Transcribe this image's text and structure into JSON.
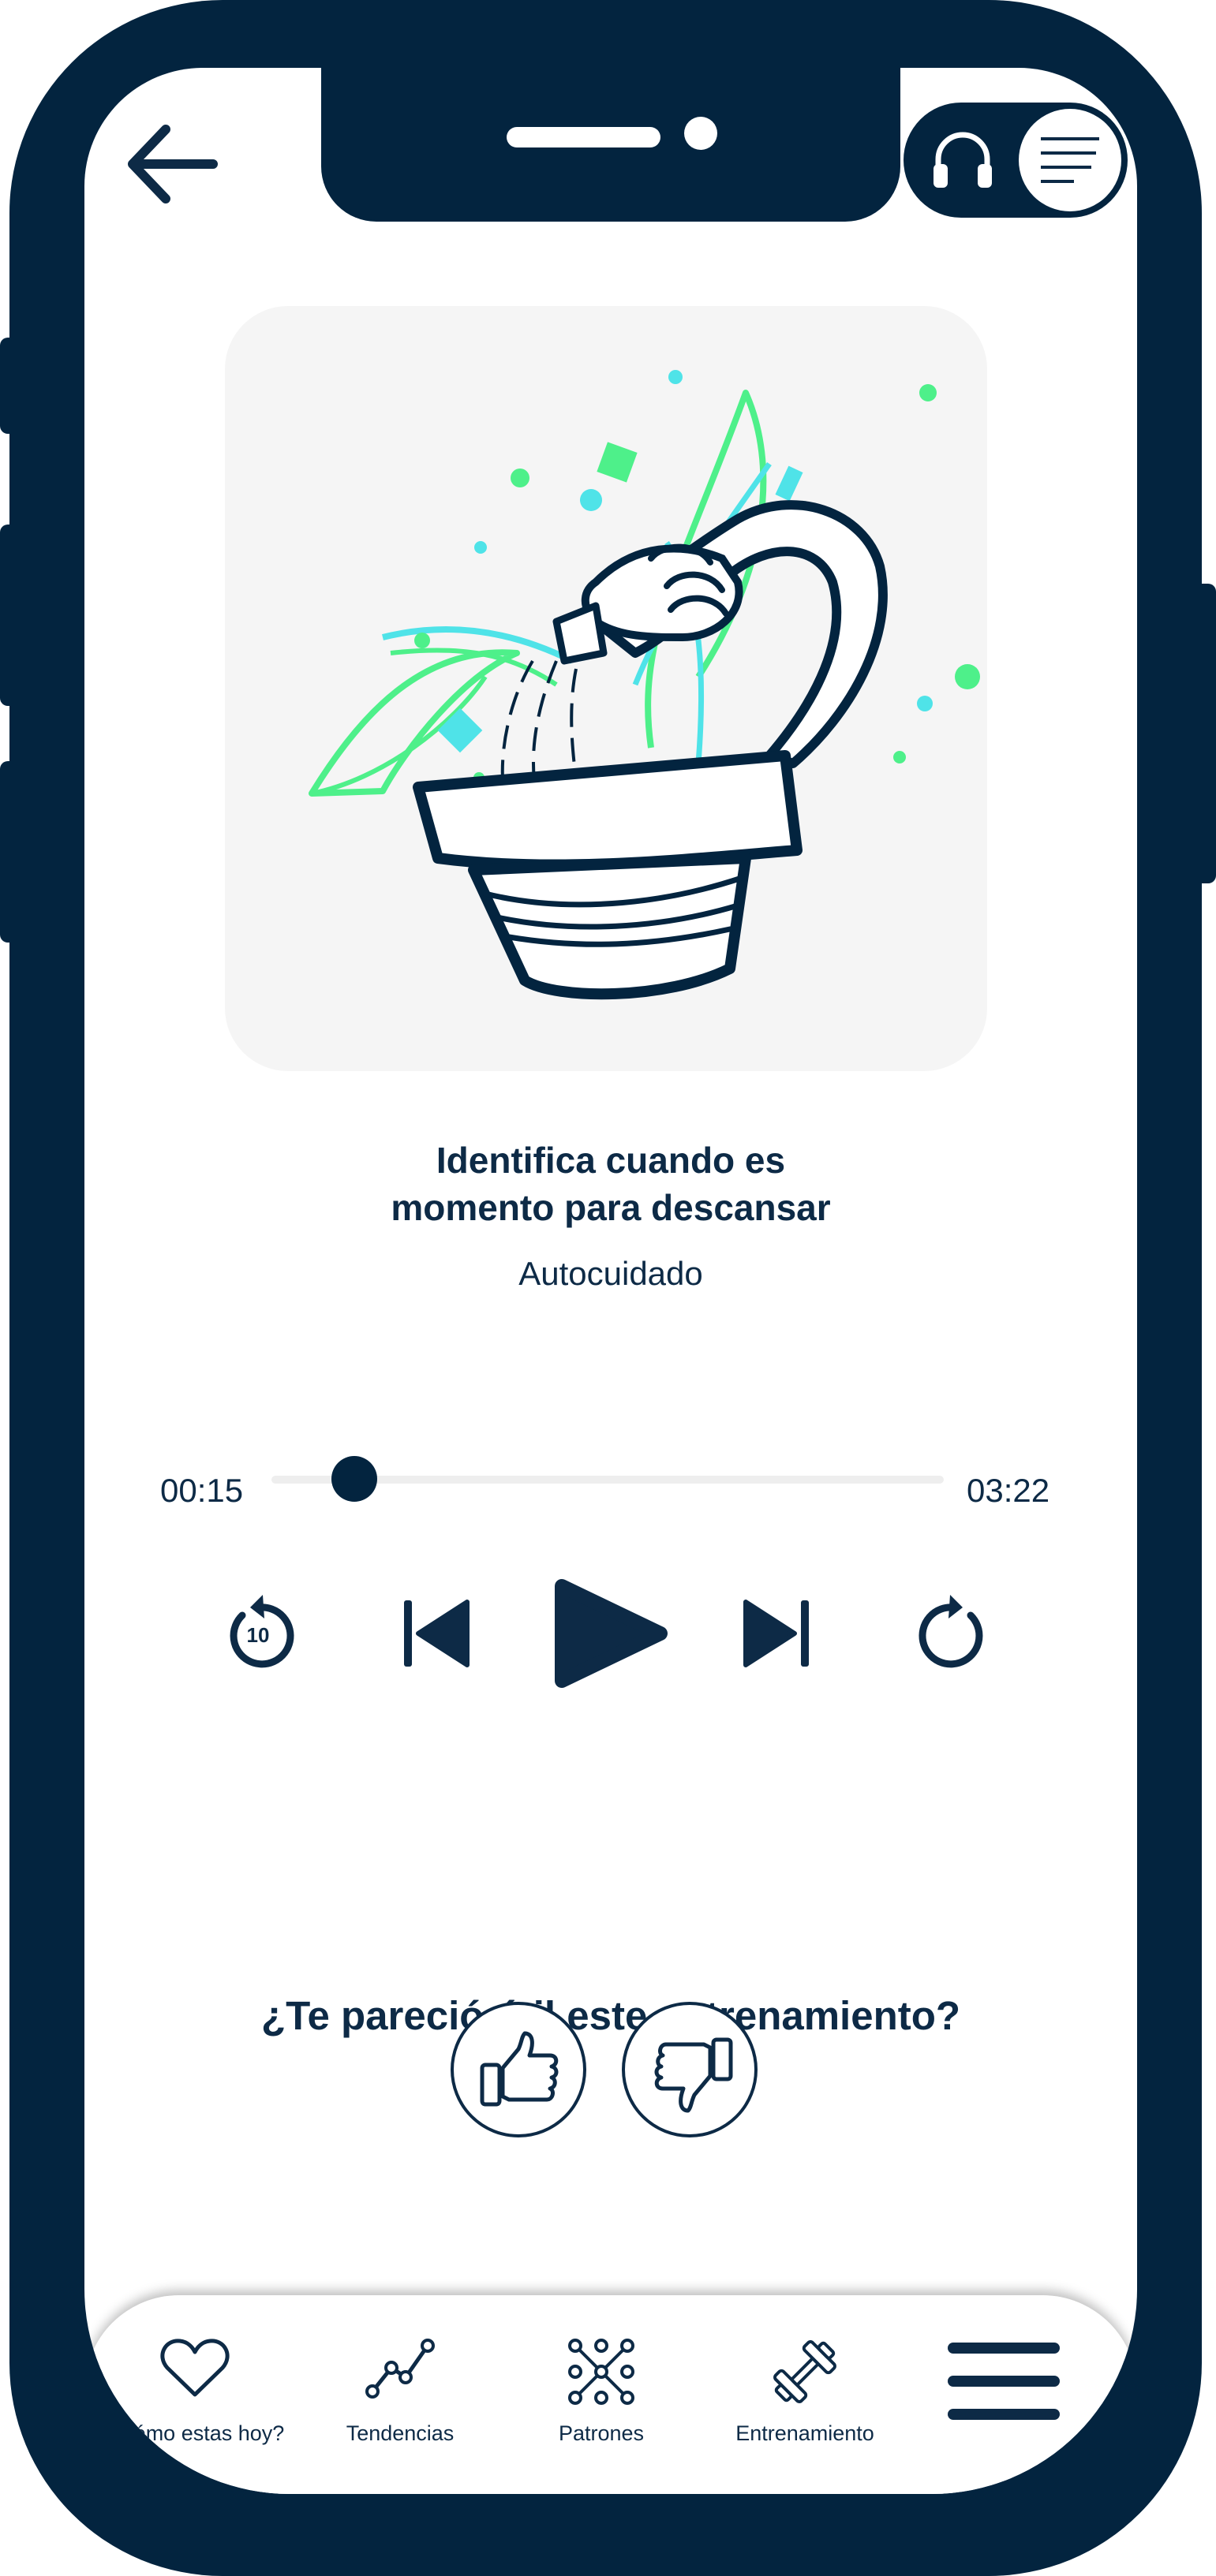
{
  "header": {
    "back_icon": "arrow-left-icon",
    "mode_toggle": {
      "audio_icon": "headphones-icon",
      "text_icon": "text-lines-icon",
      "active": "text"
    }
  },
  "track": {
    "title_line1": "Identifica cuando es",
    "title_line2": "momento para descansar",
    "category": "Autocuidado",
    "illustration": "plant-watering-illustration"
  },
  "player": {
    "elapsed": "00:15",
    "total": "03:22",
    "progress": 0.074,
    "rewind_label": "10",
    "controls": [
      "rewind-10-icon",
      "skip-previous-icon",
      "play-icon",
      "skip-next-icon",
      "forward-icon"
    ]
  },
  "feedback": {
    "question": "¿Te pareció útil este entrenamiento?",
    "like_icon": "thumbs-up-icon",
    "dislike_icon": "thumbs-down-icon"
  },
  "nav": {
    "items": [
      {
        "label": "¿Cómo estas hoy?",
        "icon": "heart-icon"
      },
      {
        "label": "Tendencias",
        "icon": "trend-line-icon"
      },
      {
        "label": "Patrones",
        "icon": "pattern-grid-icon"
      },
      {
        "label": "Entrenamiento",
        "icon": "dumbbell-icon"
      }
    ],
    "menu_icon": "hamburger-menu-icon"
  },
  "colors": {
    "navy": "#03243f",
    "text": "#0d2a46",
    "green": "#4ef08a",
    "cyan": "#4fe3e8",
    "card": "#f5f5f5"
  }
}
